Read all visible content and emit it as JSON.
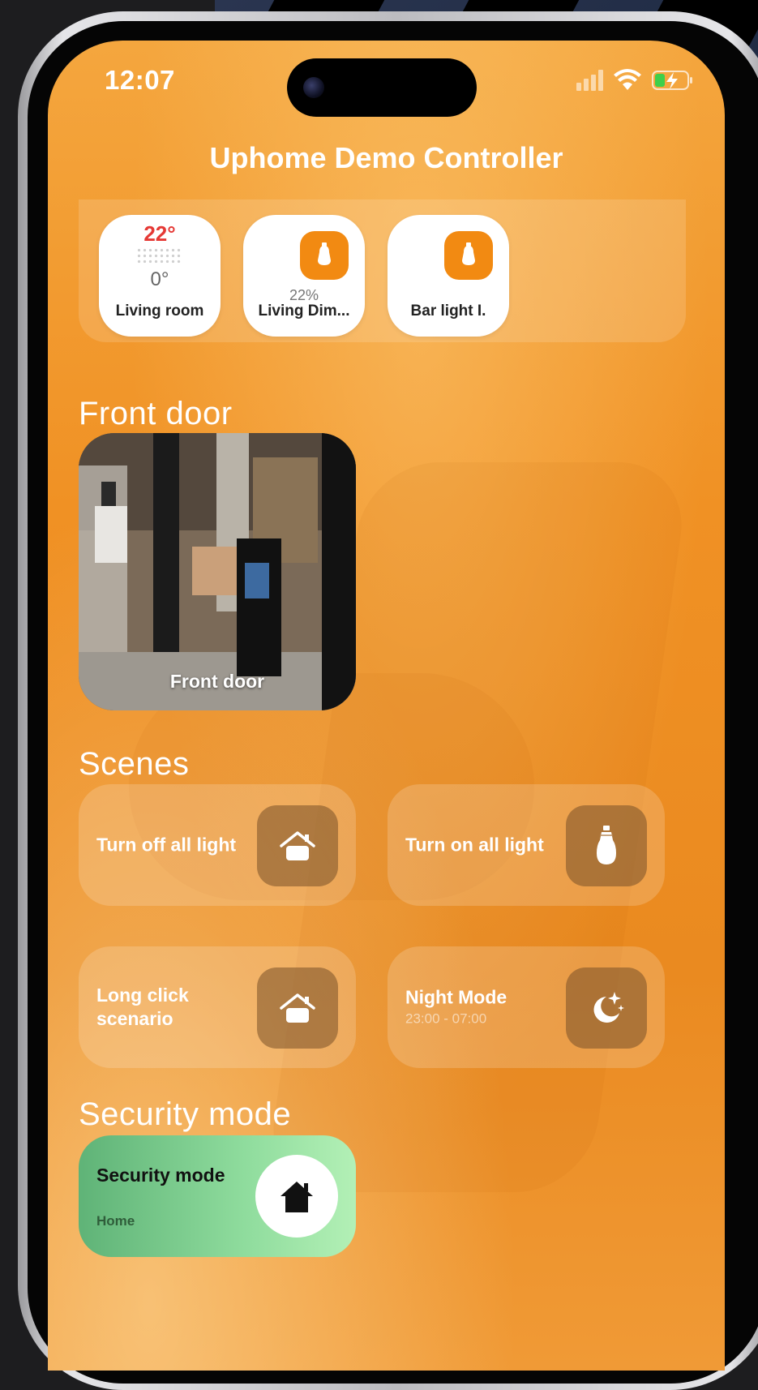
{
  "status_bar": {
    "time": "12:07"
  },
  "header": {
    "title": "Uphome Demo Controller"
  },
  "favorites": [
    {
      "name": "Living room",
      "temperature": "22°",
      "sub_temperature": "0°",
      "icon": "thermostat"
    },
    {
      "name": "Living Dim...",
      "level": "22%",
      "icon": "bulb-icon"
    },
    {
      "name": "Bar light I.",
      "icon": "bulb-icon"
    }
  ],
  "front_door": {
    "section_title": "Front door",
    "camera_label": "Front door"
  },
  "scenes": {
    "section_title": "Scenes",
    "items": [
      {
        "name": "Turn off all light",
        "icon": "house-icon"
      },
      {
        "name": "Turn on all light",
        "icon": "bulb-icon"
      },
      {
        "name": "Long click scenario",
        "icon": "house-icon"
      },
      {
        "name": "Night Mode",
        "schedule": "23:00 - 07:00",
        "icon": "moon-icon"
      }
    ]
  },
  "security": {
    "section_title": "Security mode",
    "card_name": "Security mode",
    "card_status": "Home",
    "icon": "house-icon"
  },
  "colors": {
    "accent": "#f28a12",
    "temperature": "#e53935",
    "security_green": "#8fdc9d"
  }
}
